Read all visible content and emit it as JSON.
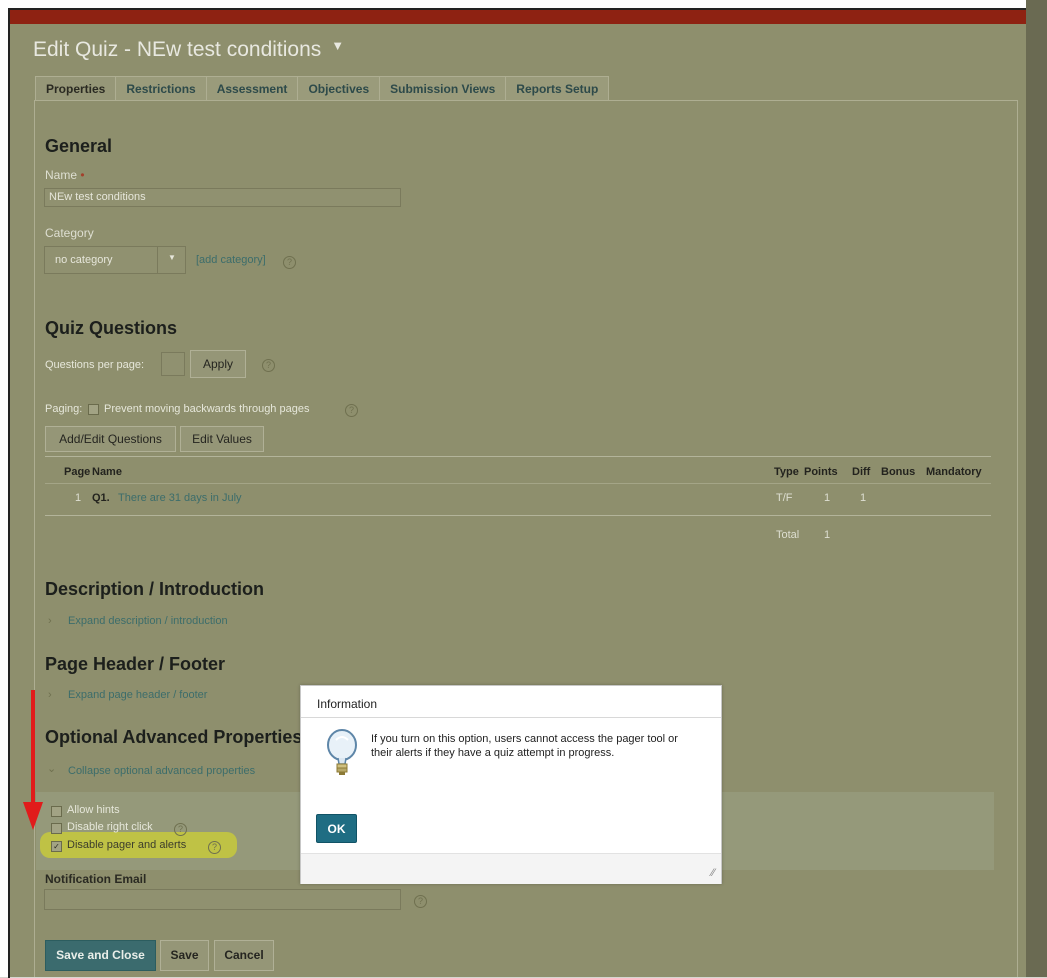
{
  "page_title": "Edit Quiz - NEw test conditions",
  "title_caret": "▼",
  "tabs": [
    {
      "label": "Properties"
    },
    {
      "label": "Restrictions"
    },
    {
      "label": "Assessment"
    },
    {
      "label": "Objectives"
    },
    {
      "label": "Submission Views"
    },
    {
      "label": "Reports Setup"
    }
  ],
  "general": {
    "heading": "General",
    "name_label": "Name",
    "required_marker": "•",
    "name_value": "NEw test conditions",
    "category_label": "Category",
    "category_value": "no category",
    "add_category": "[add category]"
  },
  "quiz_questions": {
    "heading": "Quiz Questions",
    "per_page_label": "Questions per page:",
    "per_page_value": "",
    "apply_label": "Apply",
    "paging_label": "Paging:",
    "paging_option": "Prevent moving backwards through pages",
    "add_edit_label": "Add/Edit Questions",
    "edit_values_label": "Edit Values",
    "columns": [
      "Page",
      "Name",
      "Type",
      "Points",
      "Diff",
      "Bonus",
      "Mandatory"
    ],
    "rows": [
      {
        "page": "1",
        "qnum": "Q1.",
        "name": "There are 31 days in July",
        "type": "T/F",
        "points": "1",
        "diff": "1"
      }
    ],
    "total_label": "Total",
    "total_value": "1"
  },
  "description": {
    "heading": "Description / Introduction",
    "expand_link": "Expand description / introduction"
  },
  "header_footer": {
    "heading": "Page Header / Footer",
    "expand_link": "Expand page header / footer"
  },
  "advanced": {
    "heading": "Optional Advanced Properties",
    "collapse_link": "Collapse optional advanced properties",
    "options": [
      {
        "label": "Allow hints",
        "checked": false
      },
      {
        "label": "Disable right click",
        "checked": false
      },
      {
        "label": "Disable pager and alerts",
        "checked": true
      }
    ],
    "notification_label": "Notification Email",
    "notification_value": ""
  },
  "footer_buttons": {
    "save_close": "Save and Close",
    "save": "Save",
    "cancel": "Cancel"
  },
  "dialog": {
    "title": "Information",
    "message": "If you turn on this option, users cannot access the pager tool or their alerts if they have a quiz attempt in progress.",
    "ok_label": "OK",
    "icon": "lightbulb-icon"
  },
  "annotation_color": "#e11b1b",
  "highlight_color": "#c7c93c"
}
